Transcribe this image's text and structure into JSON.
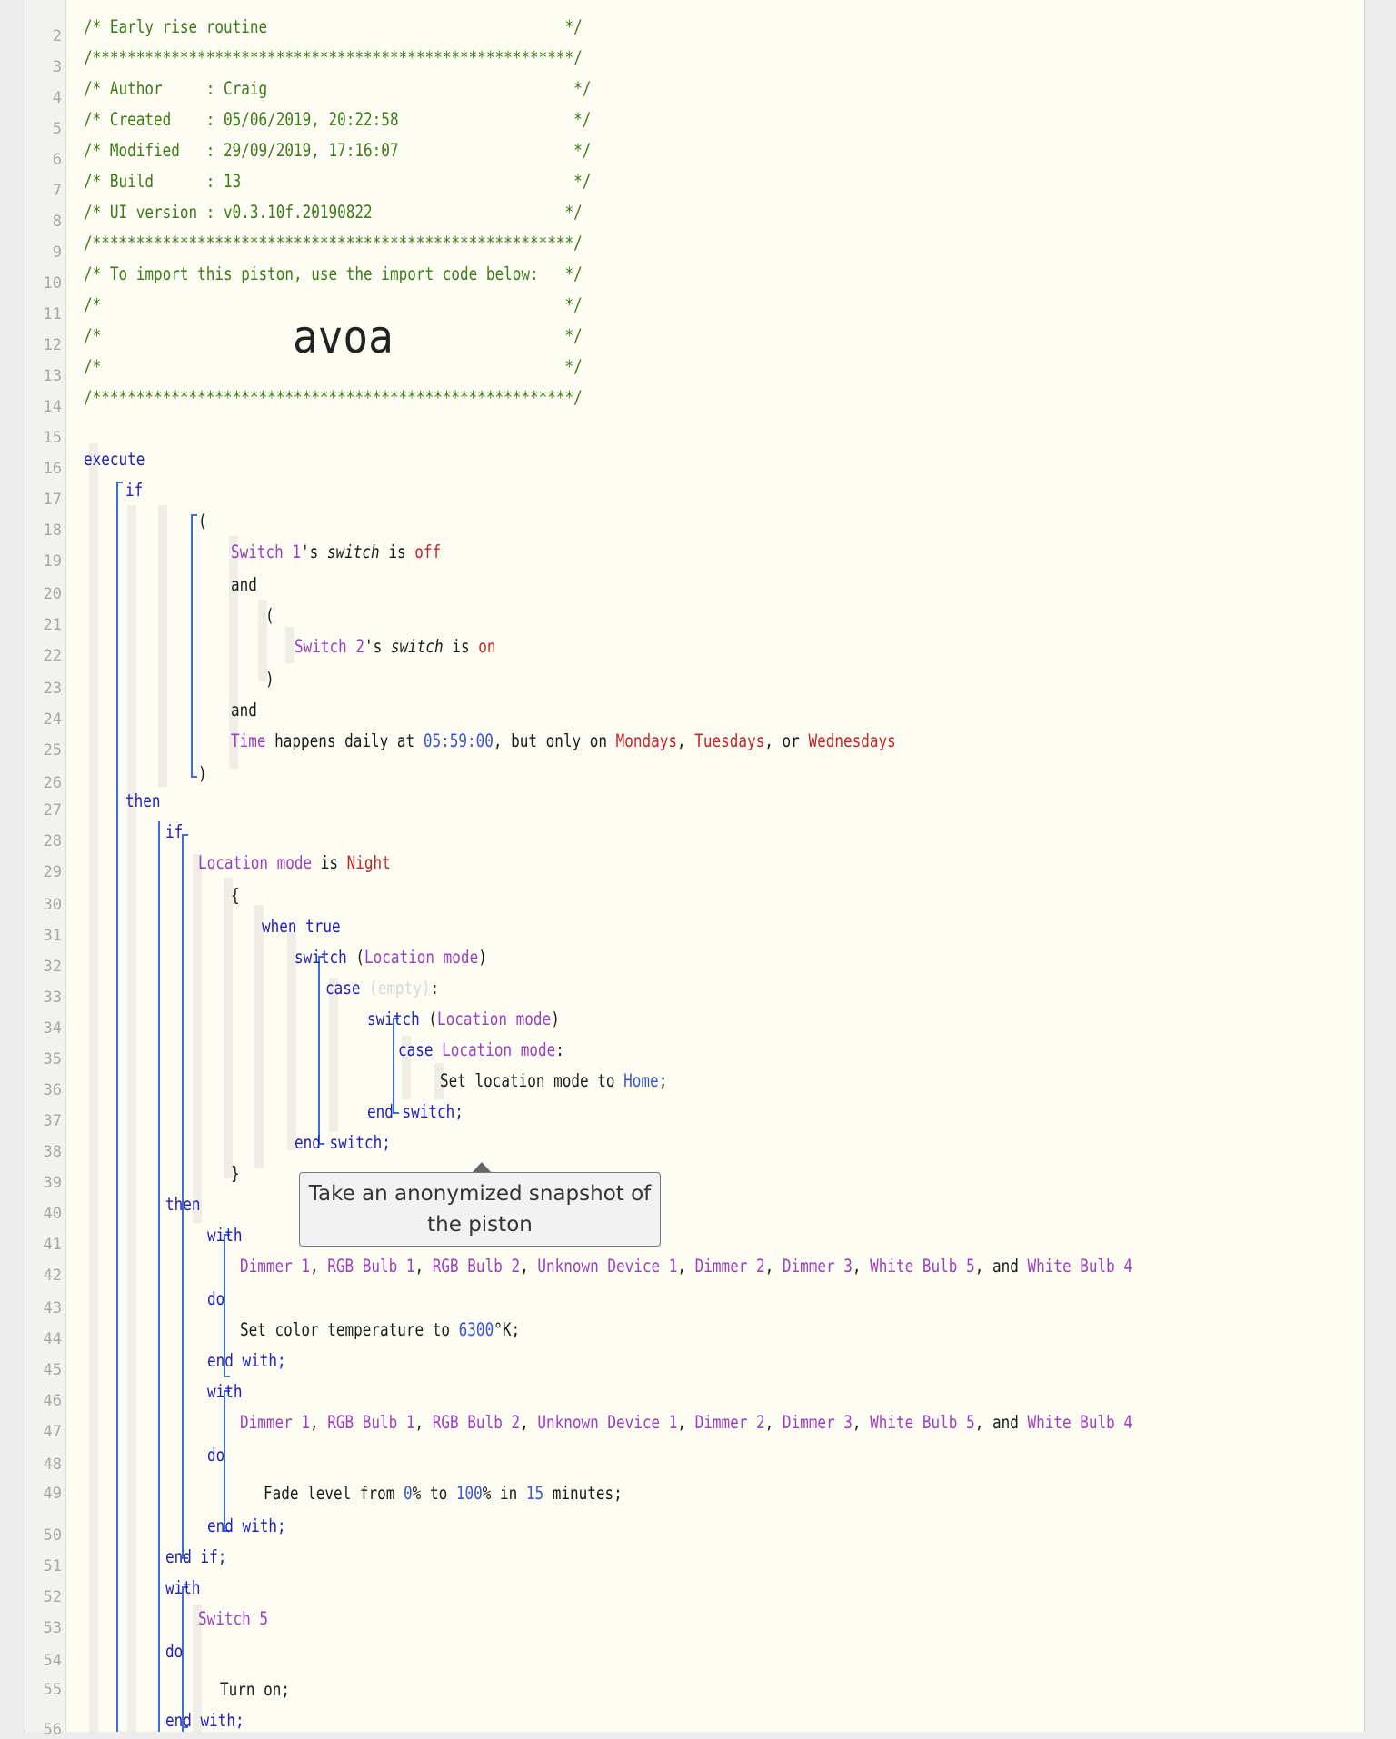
{
  "header": {
    "title_line": "/* Early rise routine                                  */",
    "sep": "/*******************************************************/",
    "author": "/* Author     : Craig                                   */",
    "created": "/* Created    : 05/06/2019, 20:22:58                    */",
    "modified": "/* Modified   : 29/09/2019, 17:16:07                    */",
    "build": "/* Build      : 13                                      */",
    "ui_version": "/* UI version : v0.3.10f.20190822                      */",
    "import_note": "/* To import this piston, use the import code below:   */",
    "blank": "/*                                                     */",
    "import_code": "avoa"
  },
  "code": {
    "execute": "execute",
    "if": "if",
    "then": "then",
    "and": "and",
    "lparen": "(",
    "rparen": ")",
    "lbrace": "{",
    "rbrace": "}",
    "switch1_dev": "Switch 1",
    "apos_s": "'s",
    "switch_word": "switch",
    "is": "is",
    "off": "off",
    "on": "on",
    "switch2_dev": "Switch 2",
    "time_word": "Time",
    "happens_daily": "happens daily at",
    "time_val": "05:59:00",
    "but_only": ", but only on",
    "mondays": "Mondays",
    "tuesdays": "Tuesdays",
    "or_word": ", or",
    "wednesdays": "Wednesdays",
    "comma": ",",
    "location_mode": "Location mode",
    "night": "Night",
    "when_true": "when true",
    "switch_kw": "switch",
    "case_kw": "case",
    "empty": "(empty)",
    "colon": ":",
    "set_loc_mode": "Set location mode to",
    "home": "Home",
    "semicolon": ";",
    "end_switch": "end switch;",
    "with_kw": "with",
    "do_kw": "do",
    "end_with": "end with;",
    "end_if": "end if;",
    "devices": [
      "Dimmer 1",
      "RGB Bulb 1",
      "RGB Bulb 2",
      "Unknown Device 1",
      "Dimmer 2",
      "Dimmer 3",
      "White Bulb 5"
    ],
    "and_last": ", and",
    "last_device": "White Bulb 4",
    "set_color_temp": "Set color temperature to",
    "color_temp_val": "6300",
    "kelvin": "°K;",
    "fade_level": "Fade level from",
    "from_val": "0",
    "pct": "%",
    "to_word": "to",
    "to_val": "100",
    "in_word": "in",
    "minutes_val": "15",
    "minutes": "minutes;",
    "switch5_dev": "Switch 5",
    "turn_on": "Turn on;"
  },
  "tooltip": {
    "text": "Take an anonymized snapshot of the piston"
  },
  "line_numbers": [
    "2",
    "3",
    "4",
    "5",
    "6",
    "7",
    "8",
    "9",
    "10",
    "11",
    "12",
    "13",
    "14",
    "15",
    "16",
    "17",
    "18",
    "19",
    "20",
    "21",
    "22",
    "23",
    "24",
    "25",
    "26",
    "27",
    "28",
    "29",
    "30",
    "31",
    "32",
    "33",
    "34",
    "35",
    "36",
    "37",
    "38",
    "39",
    "40",
    "41",
    "42",
    "43",
    "44",
    "45",
    "46",
    "47",
    "48",
    "49",
    "50",
    "51",
    "52",
    "53",
    "54",
    "55",
    "56"
  ],
  "colors": {
    "comment": "#3d7a18",
    "keyword": "#2020b8",
    "device": "#9b3fc4",
    "value": "#c0262a",
    "number": "#3a56cc"
  }
}
